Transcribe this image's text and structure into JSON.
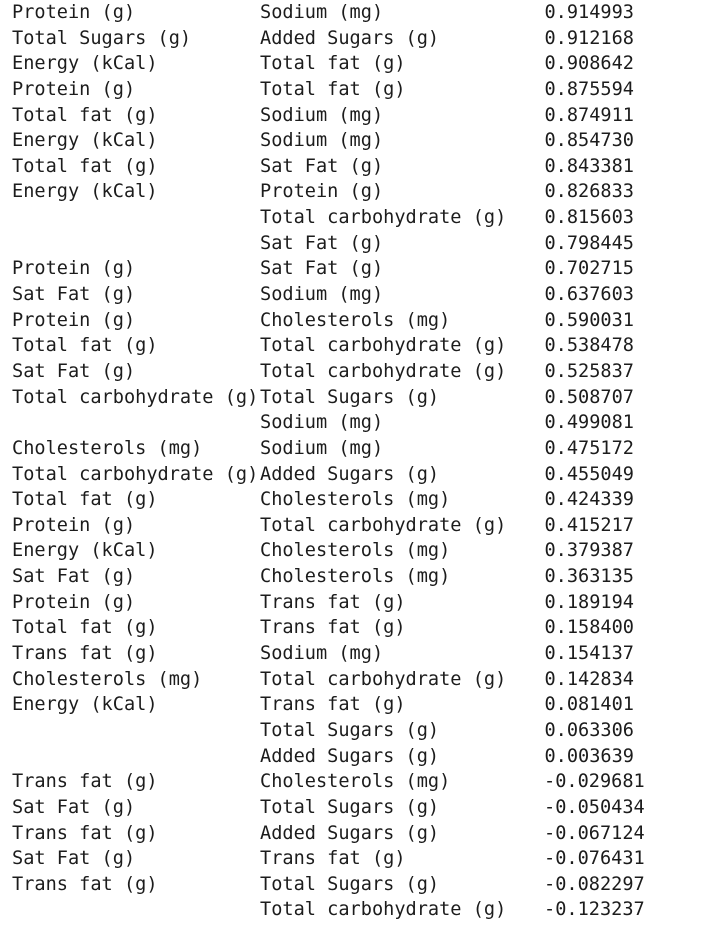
{
  "page": {
    "background_color": "#ffffff",
    "text_color": "#1c1c1c",
    "columns": 3,
    "row_count": 36
  },
  "table": {
    "column_headers": [
      "",
      "",
      ""
    ],
    "rows": [
      {
        "feature_a": "Protein (g)",
        "feature_b": "Sodium (mg)",
        "value": "0.914993"
      },
      {
        "feature_a": "Total Sugars (g)",
        "feature_b": "Added Sugars (g)",
        "value": "0.912168"
      },
      {
        "feature_a": "Energy (kCal)",
        "feature_b": "Total fat (g)",
        "value": "0.908642"
      },
      {
        "feature_a": "Protein (g)",
        "feature_b": "Total fat (g)",
        "value": "0.875594"
      },
      {
        "feature_a": "Total fat (g)",
        "feature_b": "Sodium (mg)",
        "value": "0.874911"
      },
      {
        "feature_a": "Energy (kCal)",
        "feature_b": "Sodium (mg)",
        "value": "0.854730"
      },
      {
        "feature_a": "Total fat (g)",
        "feature_b": "Sat Fat (g)",
        "value": "0.843381"
      },
      {
        "feature_a": "Energy (kCal)",
        "feature_b": "Protein (g)",
        "value": "0.826833"
      },
      {
        "feature_a": "",
        "feature_b": "Total carbohydrate (g)",
        "value": "0.815603"
      },
      {
        "feature_a": "",
        "feature_b": "Sat Fat (g)",
        "value": "0.798445"
      },
      {
        "feature_a": "Protein (g)",
        "feature_b": "Sat Fat (g)",
        "value": "0.702715"
      },
      {
        "feature_a": "Sat Fat (g)",
        "feature_b": "Sodium (mg)",
        "value": "0.637603"
      },
      {
        "feature_a": "Protein (g)",
        "feature_b": "Cholesterols (mg)",
        "value": "0.590031"
      },
      {
        "feature_a": "Total fat (g)",
        "feature_b": "Total carbohydrate (g)",
        "value": "0.538478"
      },
      {
        "feature_a": "Sat Fat (g)",
        "feature_b": "Total carbohydrate (g)",
        "value": "0.525837"
      },
      {
        "feature_a": "Total carbohydrate (g)",
        "feature_b": "Total Sugars (g)",
        "value": "0.508707"
      },
      {
        "feature_a": "",
        "feature_b": "Sodium (mg)",
        "value": "0.499081"
      },
      {
        "feature_a": "Cholesterols (mg)",
        "feature_b": "Sodium (mg)",
        "value": "0.475172"
      },
      {
        "feature_a": "Total carbohydrate (g)",
        "feature_b": "Added Sugars (g)",
        "value": "0.455049"
      },
      {
        "feature_a": "Total fat (g)",
        "feature_b": "Cholesterols (mg)",
        "value": "0.424339"
      },
      {
        "feature_a": "Protein (g)",
        "feature_b": "Total carbohydrate (g)",
        "value": "0.415217"
      },
      {
        "feature_a": "Energy (kCal)",
        "feature_b": "Cholesterols (mg)",
        "value": "0.379387"
      },
      {
        "feature_a": "Sat Fat (g)",
        "feature_b": "Cholesterols (mg)",
        "value": "0.363135"
      },
      {
        "feature_a": "Protein (g)",
        "feature_b": "Trans fat (g)",
        "value": "0.189194"
      },
      {
        "feature_a": "Total fat (g)",
        "feature_b": "Trans fat (g)",
        "value": "0.158400"
      },
      {
        "feature_a": "Trans fat (g)",
        "feature_b": "Sodium (mg)",
        "value": "0.154137"
      },
      {
        "feature_a": "Cholesterols (mg)",
        "feature_b": "Total carbohydrate (g)",
        "value": "0.142834"
      },
      {
        "feature_a": "Energy (kCal)",
        "feature_b": "Trans fat (g)",
        "value": "0.081401"
      },
      {
        "feature_a": "",
        "feature_b": "Total Sugars (g)",
        "value": "0.063306"
      },
      {
        "feature_a": "",
        "feature_b": "Added Sugars (g)",
        "value": "0.003639"
      },
      {
        "feature_a": "Trans fat (g)",
        "feature_b": "Cholesterols (mg)",
        "value": "-0.029681"
      },
      {
        "feature_a": "Sat Fat (g)",
        "feature_b": "Total Sugars (g)",
        "value": "-0.050434"
      },
      {
        "feature_a": "Trans fat (g)",
        "feature_b": "Added Sugars (g)",
        "value": "-0.067124"
      },
      {
        "feature_a": "Sat Fat (g)",
        "feature_b": "Trans fat (g)",
        "value": "-0.076431"
      },
      {
        "feature_a": "Trans fat (g)",
        "feature_b": "Total Sugars (g)",
        "value": "-0.082297"
      },
      {
        "feature_a": "",
        "feature_b": "Total carbohydrate (g)",
        "value": "-0.123237"
      }
    ]
  }
}
